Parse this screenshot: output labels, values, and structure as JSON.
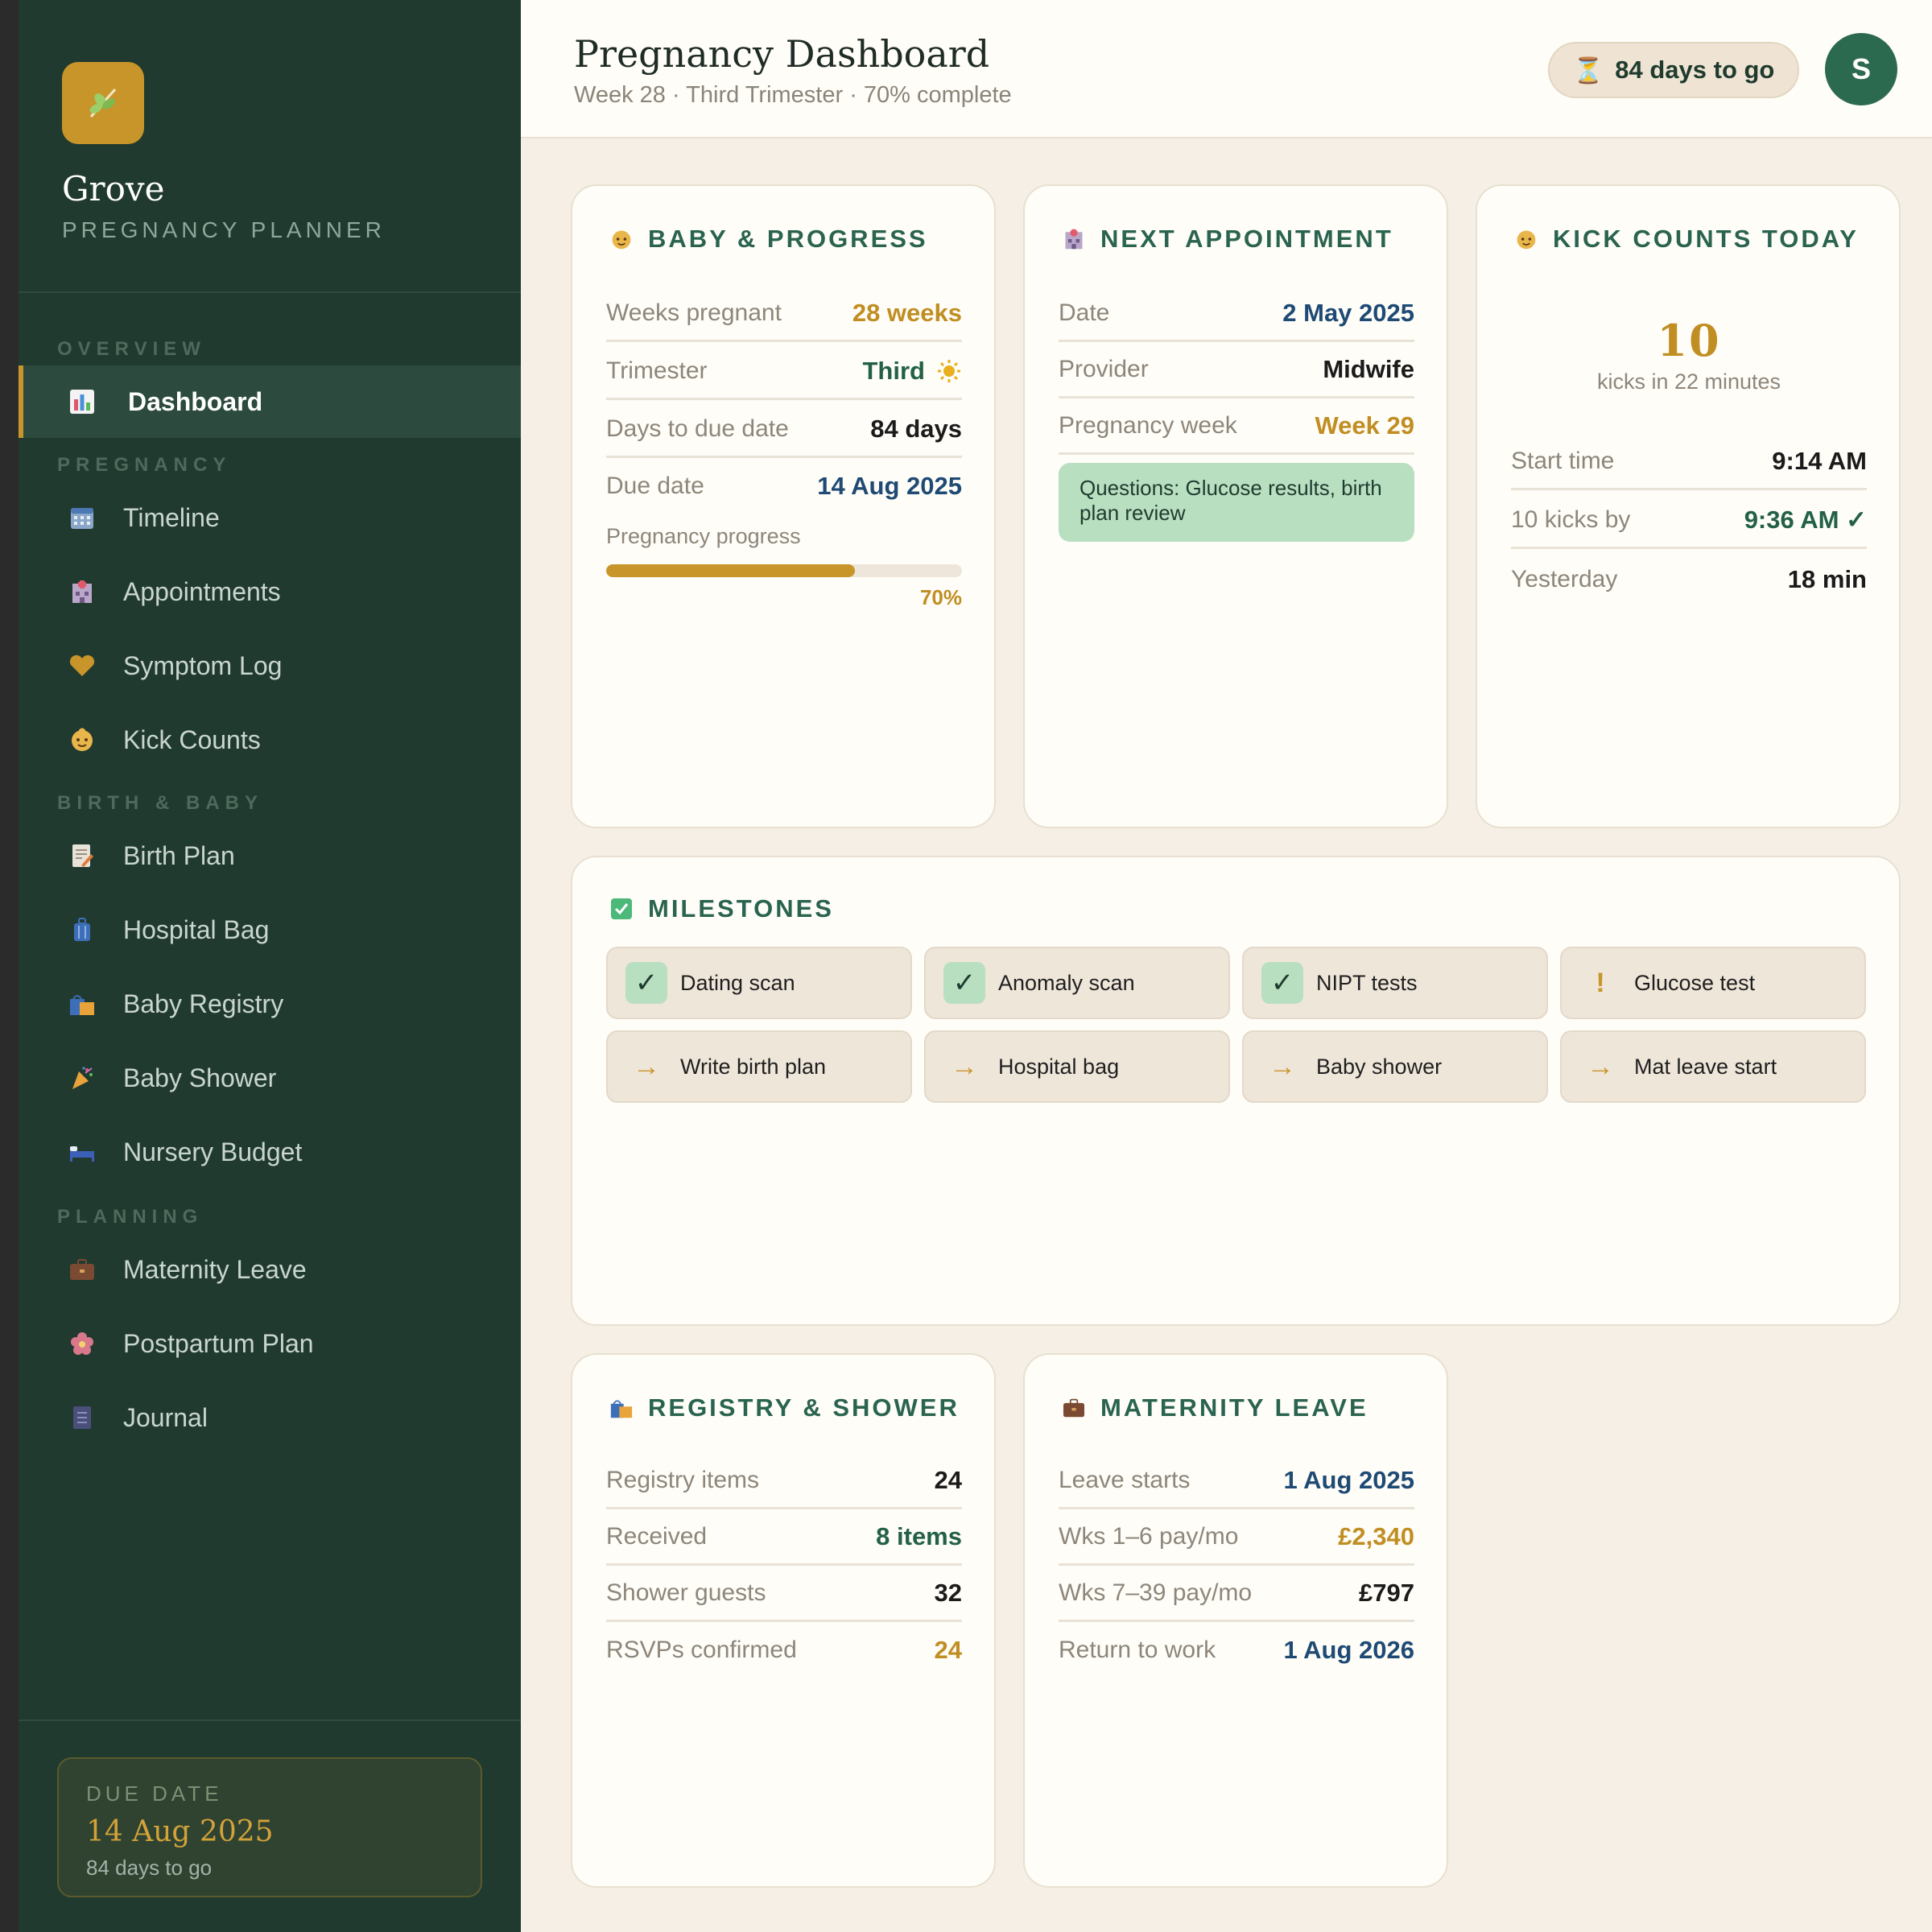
{
  "app": {
    "name": "Grove",
    "subtitle": "PREGNANCY PLANNER"
  },
  "sidebar": {
    "sections": {
      "overview": "OVERVIEW",
      "pregnancy": "PREGNANCY",
      "birth_baby": "BIRTH & BABY",
      "planning": "PLANNING"
    },
    "items": [
      {
        "label": "Dashboard",
        "icon": "bar-chart-icon"
      },
      {
        "label": "Timeline",
        "icon": "calendar-icon"
      },
      {
        "label": "Appointments",
        "icon": "hospital-icon"
      },
      {
        "label": "Symptom Log",
        "icon": "heart-icon"
      },
      {
        "label": "Kick Counts",
        "icon": "baby-icon"
      },
      {
        "label": "Birth Plan",
        "icon": "memo-icon"
      },
      {
        "label": "Hospital Bag",
        "icon": "luggage-icon"
      },
      {
        "label": "Baby Registry",
        "icon": "shopping-bags-icon"
      },
      {
        "label": "Baby Shower",
        "icon": "party-popper-icon"
      },
      {
        "label": "Nursery Budget",
        "icon": "bed-icon"
      },
      {
        "label": "Maternity Leave",
        "icon": "briefcase-icon"
      },
      {
        "label": "Postpartum Plan",
        "icon": "blossom-icon"
      },
      {
        "label": "Journal",
        "icon": "notebook-icon"
      }
    ],
    "due": {
      "label": "DUE DATE",
      "date": "14 Aug 2025",
      "remaining": "84 days to go"
    }
  },
  "header": {
    "title": "Pregnancy Dashboard",
    "subtitle": "Week 28 · Third Trimester · 70% complete",
    "days_pill": "84 days to go",
    "avatar_initial": "S"
  },
  "baby_progress": {
    "title": "BABY & PROGRESS",
    "rows": [
      {
        "k": "Weeks pregnant",
        "v": "28 weeks"
      },
      {
        "k": "Trimester",
        "v": "Third"
      },
      {
        "k": "Days to due date",
        "v": "84 days"
      },
      {
        "k": "Due date",
        "v": "14 Aug 2025"
      }
    ],
    "progress_label": "Pregnancy progress",
    "progress_value": 0.7,
    "progress_text": "70%"
  },
  "next_appointment": {
    "title": "NEXT APPOINTMENT",
    "rows": [
      {
        "k": "Date",
        "v": "2 May 2025"
      },
      {
        "k": "Provider",
        "v": "Midwife"
      },
      {
        "k": "Pregnancy week",
        "v": "Week 29"
      }
    ],
    "note": "Questions: Glucose results, birth plan review"
  },
  "kick_counts": {
    "title": "KICK COUNTS TODAY",
    "count": "10",
    "count_sub": "kicks in 22 minutes",
    "rows": [
      {
        "k": "Start time",
        "v": "9:14 AM"
      },
      {
        "k": "10 kicks by",
        "v": "9:36 AM ✓"
      },
      {
        "k": "Yesterday",
        "v": "18 min"
      }
    ]
  },
  "milestones": {
    "title": "MILESTONES",
    "items": [
      {
        "label": "Dating scan",
        "status": "done",
        "mark": "✓"
      },
      {
        "label": "Anomaly scan",
        "status": "done",
        "mark": "✓"
      },
      {
        "label": "NIPT tests",
        "status": "done",
        "mark": "✓"
      },
      {
        "label": "Glucose test",
        "status": "warn",
        "mark": "!"
      },
      {
        "label": "Write birth plan",
        "status": "next",
        "mark": "→"
      },
      {
        "label": "Hospital bag",
        "status": "next",
        "mark": "→"
      },
      {
        "label": "Baby shower",
        "status": "next",
        "mark": "→"
      },
      {
        "label": "Mat leave start",
        "status": "next",
        "mark": "→"
      }
    ]
  },
  "registry": {
    "title": "REGISTRY & SHOWER",
    "rows": [
      {
        "k": "Registry items",
        "v": "24"
      },
      {
        "k": "Received",
        "v": "8 items"
      },
      {
        "k": "Shower guests",
        "v": "32"
      },
      {
        "k": "RSVPs confirmed",
        "v": "24"
      }
    ]
  },
  "maternity_leave": {
    "title": "MATERNITY LEAVE",
    "rows": [
      {
        "k": "Leave starts",
        "v": "1 Aug 2025"
      },
      {
        "k": "Wks 1–6 pay/mo",
        "v": "£2,340"
      },
      {
        "k": "Wks 7–39 pay/mo",
        "v": "£797"
      },
      {
        "k": "Return to work",
        "v": "1 Aug 2026"
      }
    ]
  },
  "colors": {
    "sidebar": "#213a2f",
    "accent_gold": "#c8952a",
    "accent_green": "#2a6450",
    "background": "#f5efe5"
  }
}
